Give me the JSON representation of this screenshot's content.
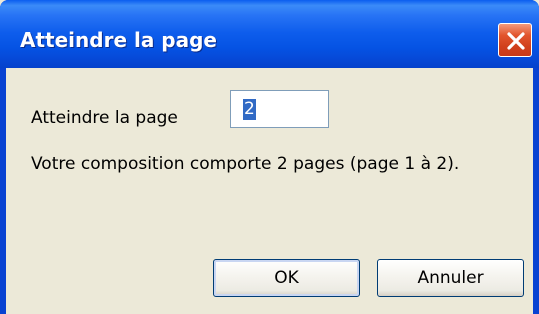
{
  "window": {
    "title": "Atteindre la page"
  },
  "form": {
    "page_label": "Atteindre la page",
    "page_value": "2",
    "info": "Votre composition comporte 2 pages (page 1 à 2)."
  },
  "buttons": {
    "ok_label": "OK",
    "cancel_label": "Annuler"
  },
  "icons": {
    "close": "close-icon"
  },
  "colors": {
    "titlebar": "#0553E4",
    "close_button": "#D1401C",
    "client_background": "#ECE9D8",
    "selection": "#316AC5"
  }
}
